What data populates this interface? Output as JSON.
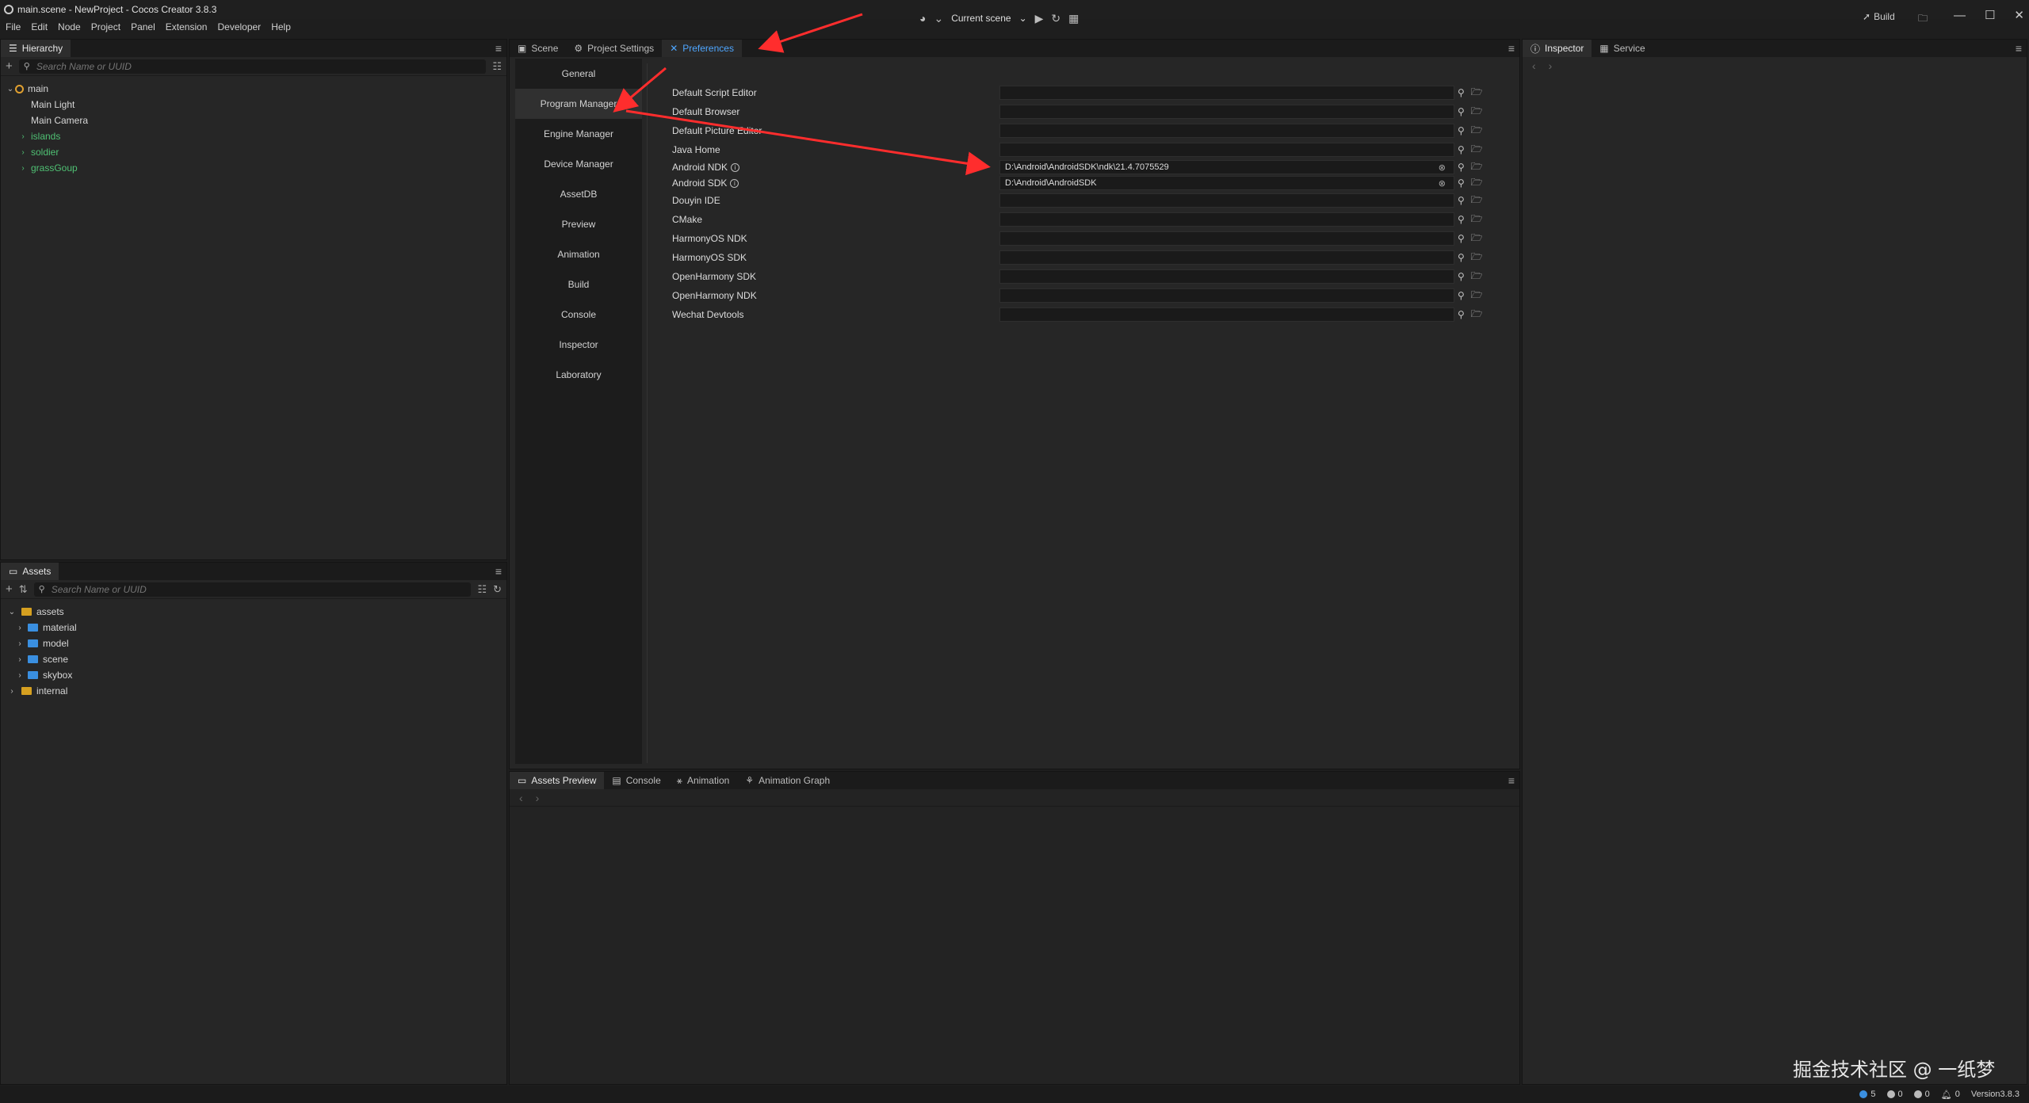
{
  "window": {
    "title": "main.scene - NewProject - Cocos Creator 3.8.3",
    "controls": [
      "minimize-icon",
      "maximize-icon",
      "close-icon"
    ]
  },
  "menu": [
    "File",
    "Edit",
    "Node",
    "Project",
    "Panel",
    "Extension",
    "Developer",
    "Help"
  ],
  "toolbar": {
    "scene_select": "Current scene",
    "build_label": "Build"
  },
  "hierarchy": {
    "tab": "Hierarchy",
    "search_placeholder": "Search Name or UUID",
    "nodes": [
      {
        "label": "main",
        "level": 0
      },
      {
        "label": "Main Light",
        "level": 1
      },
      {
        "label": "Main Camera",
        "level": 1
      },
      {
        "label": "islands",
        "level": 1
      },
      {
        "label": "soldier",
        "level": 1
      },
      {
        "label": "grassGoup",
        "level": 1
      }
    ]
  },
  "assets": {
    "tab": "Assets",
    "search_placeholder": "Search Name or UUID",
    "items": [
      {
        "label": "assets"
      },
      {
        "label": "material"
      },
      {
        "label": "model"
      },
      {
        "label": "scene"
      },
      {
        "label": "skybox"
      },
      {
        "label": "internal"
      }
    ]
  },
  "center_tabs": [
    "Scene",
    "Project Settings",
    "Preferences"
  ],
  "preferences": {
    "nav": [
      "General",
      "Program Manager",
      "Engine Manager",
      "Device Manager",
      "AssetDB",
      "Preview",
      "Animation",
      "Build",
      "Console",
      "Inspector",
      "Laboratory"
    ],
    "selected_nav": "Program Manager",
    "rows": [
      {
        "label": "Default Script Editor",
        "value": ""
      },
      {
        "label": "Default Browser",
        "value": ""
      },
      {
        "label": "Default Picture Editor",
        "value": ""
      },
      {
        "label": "Java Home",
        "value": ""
      },
      {
        "label": "Android NDK",
        "value": "D:\\Android\\AndroidSDK\\ndk\\21.4.7075529"
      },
      {
        "label": "Android SDK",
        "value": "D:\\Android\\AndroidSDK"
      },
      {
        "label": "Douyin IDE",
        "value": ""
      },
      {
        "label": "CMake",
        "value": ""
      },
      {
        "label": "HarmonyOS NDK",
        "value": ""
      },
      {
        "label": "HarmonyOS SDK",
        "value": ""
      },
      {
        "label": "OpenHarmony SDK",
        "value": ""
      },
      {
        "label": "OpenHarmony NDK",
        "value": ""
      },
      {
        "label": "Wechat Devtools",
        "value": ""
      }
    ]
  },
  "bottom_tabs": [
    "Assets Preview",
    "Console",
    "Animation",
    "Animation Graph"
  ],
  "right_tabs": [
    "Inspector",
    "Service"
  ],
  "status": {
    "info_count": "5",
    "warn_count": "0",
    "error_count": "0",
    "notify_count": "0",
    "version": "Version3.8.3"
  },
  "watermark": "掘金技术社区 @ 一纸梦",
  "colors": {
    "accent": "#4ea6ff",
    "node_green": "#4fc073",
    "annotation_red": "#ff2d2d"
  }
}
